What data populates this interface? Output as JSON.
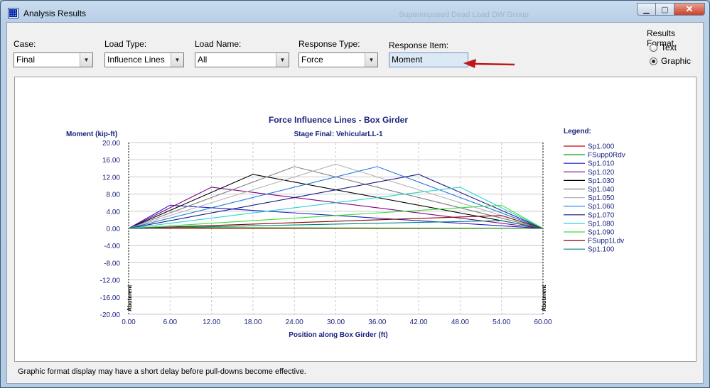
{
  "window": {
    "title": "Analysis Results",
    "ghost_text": "Superimposed Dead Load DW Group"
  },
  "controls": {
    "case": {
      "label": "Case:",
      "value": "Final"
    },
    "load_type": {
      "label": "Load Type:",
      "value": "Influence Lines"
    },
    "load_name": {
      "label": "Load Name:",
      "value": "All"
    },
    "response_type": {
      "label": "Response Type:",
      "value": "Force"
    },
    "response_item": {
      "label": "Response Item:",
      "value": "Moment"
    }
  },
  "results_format": {
    "title": "Results Format",
    "options": [
      {
        "label": "Text",
        "checked": false
      },
      {
        "label": "Graphic",
        "checked": true
      }
    ]
  },
  "status_text": "Graphic format display may have a short delay before pull-downs become effective.",
  "colors": {
    "accent": "#c0161b",
    "chart_text": "#1a237e"
  },
  "chart_data": {
    "type": "line",
    "title": "Force Influence Lines - Box Girder",
    "subtitle": "Stage Final: VehicularLL-1",
    "ylabel": "Moment (kip-ft)",
    "xlabel": "Position along Box Girder (ft)",
    "legend_title": "Legend:",
    "legend_position": "right",
    "xlim": [
      0,
      60
    ],
    "ylim": [
      -20,
      20
    ],
    "xticks": [
      "0.00",
      "6.00",
      "12.00",
      "18.00",
      "24.00",
      "30.00",
      "36.00",
      "42.00",
      "48.00",
      "54.00",
      "60.00"
    ],
    "yticks": [
      "20.00",
      "16.00",
      "12.00",
      "8.00",
      "4.00",
      "0.00",
      "-4.00",
      "-8.00",
      "-12.00",
      "-16.00",
      "-20.00"
    ],
    "grid": true,
    "support_labels": [
      "Abutment",
      "Abutment"
    ],
    "series": [
      {
        "name": "Sp1.000",
        "color": "#cc0000",
        "x": [
          0,
          60
        ],
        "y": [
          0,
          0
        ]
      },
      {
        "name": "FSupp0Rdv",
        "color": "#00a000",
        "x": [
          0,
          6,
          60
        ],
        "y": [
          0,
          0.2,
          0
        ]
      },
      {
        "name": "Sp1.010",
        "color": "#1e1ec8",
        "x": [
          0,
          6,
          60
        ],
        "y": [
          0,
          5.4,
          0
        ]
      },
      {
        "name": "Sp1.020",
        "color": "#800080",
        "x": [
          0,
          12,
          60
        ],
        "y": [
          0,
          9.6,
          0
        ]
      },
      {
        "name": "Sp1.030",
        "color": "#000000",
        "x": [
          0,
          18,
          60
        ],
        "y": [
          0,
          12.6,
          0
        ]
      },
      {
        "name": "Sp1.040",
        "color": "#808080",
        "x": [
          0,
          24,
          60
        ],
        "y": [
          0,
          14.4,
          0
        ]
      },
      {
        "name": "Sp1.050",
        "color": "#b4b4b4",
        "x": [
          0,
          30,
          60
        ],
        "y": [
          0,
          15.0,
          0
        ]
      },
      {
        "name": "Sp1.060",
        "color": "#1e78dc",
        "x": [
          0,
          36,
          60
        ],
        "y": [
          0,
          14.4,
          0
        ]
      },
      {
        "name": "Sp1.070",
        "color": "#141482",
        "x": [
          0,
          42,
          60
        ],
        "y": [
          0,
          12.6,
          0
        ]
      },
      {
        "name": "Sp1.080",
        "color": "#28d2d2",
        "x": [
          0,
          48,
          60
        ],
        "y": [
          0,
          9.6,
          0
        ]
      },
      {
        "name": "Sp1.090",
        "color": "#3cdc3c",
        "x": [
          0,
          54,
          60
        ],
        "y": [
          0,
          5.4,
          0
        ]
      },
      {
        "name": "FSupp1Ldv",
        "color": "#8b0000",
        "x": [
          0,
          54,
          60
        ],
        "y": [
          0,
          3.0,
          0
        ]
      },
      {
        "name": "Sp1.100",
        "color": "#008080",
        "x": [
          0,
          54,
          60
        ],
        "y": [
          0,
          1.8,
          0
        ]
      }
    ]
  }
}
